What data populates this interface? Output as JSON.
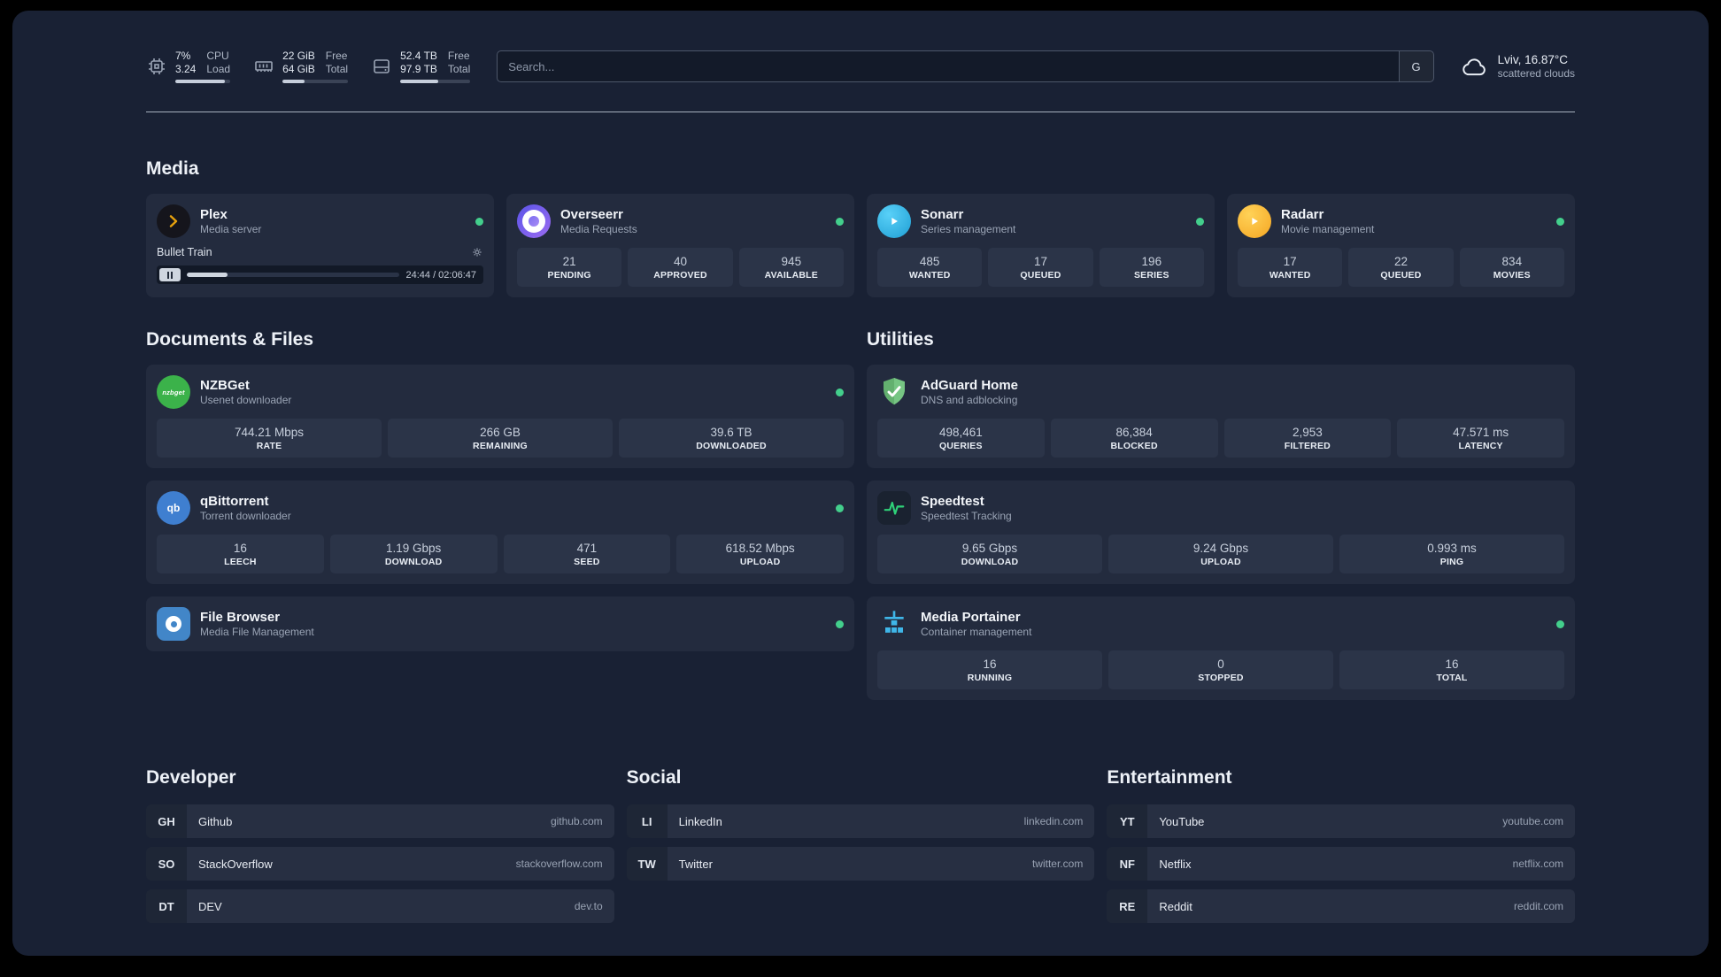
{
  "topbar": {
    "cpu": {
      "value_top": "7%",
      "label_top": "CPU",
      "value_bottom": "3.24",
      "label_bottom": "Load",
      "progress_percent": 90
    },
    "memory": {
      "value_top": "22 GiB",
      "label_top": "Free",
      "value_bottom": "64 GiB",
      "label_bottom": "Total",
      "progress_percent": 34
    },
    "disk": {
      "value_top": "52.4 TB",
      "label_top": "Free",
      "value_bottom": "97.9 TB",
      "label_bottom": "Total",
      "progress_percent": 54
    },
    "search": {
      "placeholder": "Search...",
      "provider_key": "G"
    },
    "weather": {
      "location": "Lviv, 16.87°C",
      "condition": "scattered clouds"
    }
  },
  "media": {
    "title": "Media",
    "plex": {
      "name": "Plex",
      "desc": "Media server",
      "now_playing": "Bullet Train",
      "time": "24:44 / 02:06:47",
      "progress_percent": 19
    },
    "overseerr": {
      "name": "Overseerr",
      "desc": "Media Requests",
      "stats": [
        {
          "value": "21",
          "label": "PENDING"
        },
        {
          "value": "40",
          "label": "APPROVED"
        },
        {
          "value": "945",
          "label": "AVAILABLE"
        }
      ]
    },
    "sonarr": {
      "name": "Sonarr",
      "desc": "Series management",
      "stats": [
        {
          "value": "485",
          "label": "WANTED"
        },
        {
          "value": "17",
          "label": "QUEUED"
        },
        {
          "value": "196",
          "label": "SERIES"
        }
      ]
    },
    "radarr": {
      "name": "Radarr",
      "desc": "Movie management",
      "stats": [
        {
          "value": "17",
          "label": "WANTED"
        },
        {
          "value": "22",
          "label": "QUEUED"
        },
        {
          "value": "834",
          "label": "MOVIES"
        }
      ]
    }
  },
  "documents": {
    "title": "Documents & Files",
    "nzbget": {
      "name": "NZBGet",
      "desc": "Usenet downloader",
      "stats": [
        {
          "value": "744.21 Mbps",
          "label": "RATE"
        },
        {
          "value": "266 GB",
          "label": "REMAINING"
        },
        {
          "value": "39.6 TB",
          "label": "DOWNLOADED"
        }
      ]
    },
    "qbittorrent": {
      "name": "qBittorrent",
      "desc": "Torrent downloader",
      "stats": [
        {
          "value": "16",
          "label": "LEECH"
        },
        {
          "value": "1.19 Gbps",
          "label": "DOWNLOAD"
        },
        {
          "value": "471",
          "label": "SEED"
        },
        {
          "value": "618.52 Mbps",
          "label": "UPLOAD"
        }
      ]
    },
    "filebrowser": {
      "name": "File Browser",
      "desc": "Media File Management"
    }
  },
  "utilities": {
    "title": "Utilities",
    "adguard": {
      "name": "AdGuard Home",
      "desc": "DNS and adblocking",
      "stats": [
        {
          "value": "498,461",
          "label": "QUERIES"
        },
        {
          "value": "86,384",
          "label": "BLOCKED"
        },
        {
          "value": "2,953",
          "label": "FILTERED"
        },
        {
          "value": "47.571 ms",
          "label": "LATENCY"
        }
      ]
    },
    "speedtest": {
      "name": "Speedtest",
      "desc": "Speedtest Tracking",
      "stats": [
        {
          "value": "9.65 Gbps",
          "label": "DOWNLOAD"
        },
        {
          "value": "9.24 Gbps",
          "label": "UPLOAD"
        },
        {
          "value": "0.993 ms",
          "label": "PING"
        }
      ]
    },
    "portainer": {
      "name": "Media Portainer",
      "desc": "Container management",
      "stats": [
        {
          "value": "16",
          "label": "RUNNING"
        },
        {
          "value": "0",
          "label": "STOPPED"
        },
        {
          "value": "16",
          "label": "TOTAL"
        }
      ]
    }
  },
  "links": {
    "developer": {
      "title": "Developer",
      "items": [
        {
          "abbr": "GH",
          "name": "Github",
          "domain": "github.com"
        },
        {
          "abbr": "SO",
          "name": "StackOverflow",
          "domain": "stackoverflow.com"
        },
        {
          "abbr": "DT",
          "name": "DEV",
          "domain": "dev.to"
        }
      ]
    },
    "social": {
      "title": "Social",
      "items": [
        {
          "abbr": "LI",
          "name": "LinkedIn",
          "domain": "linkedin.com"
        },
        {
          "abbr": "TW",
          "name": "Twitter",
          "domain": "twitter.com"
        }
      ]
    },
    "entertainment": {
      "title": "Entertainment",
      "items": [
        {
          "abbr": "YT",
          "name": "YouTube",
          "domain": "youtube.com"
        },
        {
          "abbr": "NF",
          "name": "Netflix",
          "domain": "netflix.com"
        },
        {
          "abbr": "RE",
          "name": "Reddit",
          "domain": "reddit.com"
        }
      ]
    }
  },
  "icons": {
    "nzbget_label": "nzbget",
    "qbittorrent_label": "qb"
  },
  "colors": {
    "status_online": "#43cf8c",
    "accent_plex": "#e5a00d",
    "accent_sonarr": "#35c5f4",
    "accent_radarr": "#ffc230",
    "accent_adguard": "#67b57a",
    "accent_speedtest": "#2fd179",
    "accent_portainer": "#3fb6e8"
  }
}
